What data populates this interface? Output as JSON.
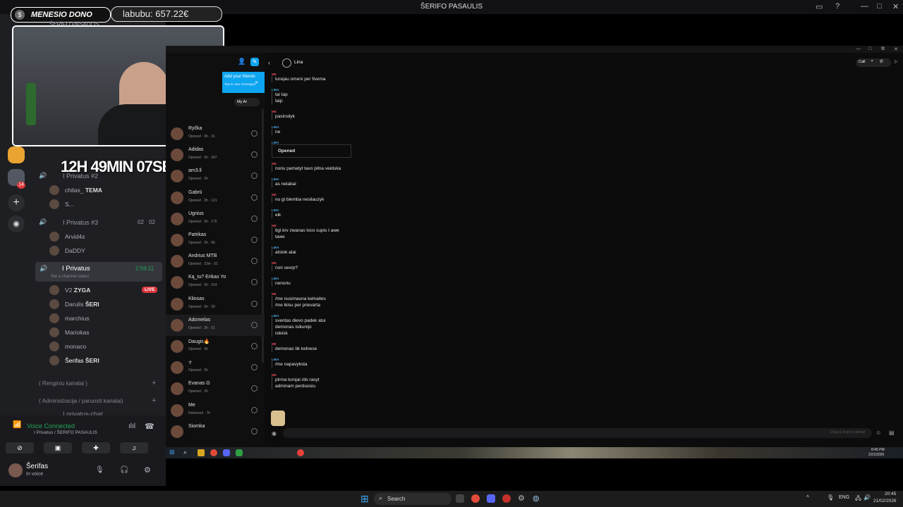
{
  "window": {
    "title": "ŠERIFO PASAULIS"
  },
  "overlay": {
    "donation_label": "MENESIO DONO",
    "donation_value": "labubu: 657.22€",
    "timer": "12H 49MIN 07SEC",
    "server_name": "ŠERIFO PASAULIS"
  },
  "channels": {
    "voice1": {
      "name": "I Privatus #2"
    },
    "voice1_members": [
      {
        "name": "chilas_",
        "tag": "TEMA"
      },
      {
        "name": "S..."
      }
    ],
    "voice2": {
      "name": "I Privatus #3",
      "count_a": "02",
      "count_b": "02"
    },
    "voice2_members": [
      {
        "name": "Arvid4s"
      },
      {
        "name": "DaDDY"
      }
    ],
    "voice3": {
      "name": "I Privatus",
      "timer": "2:59:11",
      "status": "Set a channel status"
    },
    "voice3_members": [
      {
        "name": "V2",
        "tag": "ZYGA",
        "live": "LIVE"
      },
      {
        "name": "Darulis",
        "tag": "ŠERI"
      },
      {
        "name": "marchius"
      },
      {
        "name": "Mariokas"
      },
      {
        "name": "monaco"
      },
      {
        "name": "Šerifas",
        "tag": "ŠERI"
      }
    ],
    "category1": "( Renginiu kanalai )",
    "category2": "( Administracija / paruosti kanalai)",
    "text_channel": "I privatus-chat",
    "guild_badge": "14"
  },
  "voice_panel": {
    "status": "Voice Connected",
    "location": "I Privatus / ŠERIFO PASAULIS",
    "username": "Šerifas",
    "user_status": "In voice"
  },
  "snap": {
    "banner_title": "Add your friends",
    "banner_sub": "Tap to view messages",
    "myai": "My AI",
    "contact": "Lina",
    "call_label": "Call",
    "input_placeholder": "Drag & drop to upload",
    "chats": [
      {
        "name": "Ryčka",
        "status": "Opened · 3h · 31"
      },
      {
        "name": "Adidas",
        "status": "Opened · 3h · 347"
      },
      {
        "name": "am3.ll",
        "status": "Opened · 3h"
      },
      {
        "name": "Gabrū",
        "status": "Opened · 3h · 121"
      },
      {
        "name": "Ugnius",
        "status": "Opened · 3h · 175"
      },
      {
        "name": "Patrikas",
        "status": "Opened · 3h · 96"
      },
      {
        "name": "Andrius MTB",
        "status": "Opened · 23m · 51"
      },
      {
        "name": "Ką_tu? Erikas Yo",
        "status": "Opened · 3h · 314"
      },
      {
        "name": "Kliosas",
        "status": "Opened · 3h · 30"
      },
      {
        "name": "Adomelas",
        "status": "Opened · 3h · 21"
      },
      {
        "name": "Daugis🔥",
        "status": "Opened · 3h"
      },
      {
        "name": "☥",
        "status": "Opened · 3h"
      },
      {
        "name": "Evanas G",
        "status": "Opened · 3h"
      },
      {
        "name": "Me",
        "status": "Delivered · 7h"
      },
      {
        "name": "Siomka"
      }
    ],
    "messages": [
      {
        "who": "ME",
        "lines": [
          "turejau omeni per fivema"
        ]
      },
      {
        "who": "LINA",
        "lines": [
          "tai tap",
          "taip"
        ]
      },
      {
        "who": "ME",
        "lines": [
          "pasirodyk"
        ]
      },
      {
        "who": "LINA",
        "lines": [
          "ne"
        ]
      },
      {
        "who": "LINA",
        "lines": [
          "Opened"
        ]
      },
      {
        "who": "ME",
        "lines": [
          "noriu pamatyt tavo pilna veiduka"
        ]
      },
      {
        "who": "LINA",
        "lines": [
          "as nelabai"
        ]
      },
      {
        "who": "ME",
        "lines": [
          "nu gi blemba nesilauzyk"
        ]
      },
      {
        "who": "LINA",
        "lines": [
          "eik"
        ]
      },
      {
        "who": "ME",
        "lines": [
          "tigi krv zwanas loco supis t awe",
          "tawe"
        ]
      },
      {
        "who": "LINA",
        "lines": [
          "atstok atai"
        ]
      },
      {
        "who": "ME",
        "lines": [
          "nori sexrp?"
        ]
      },
      {
        "who": "LINA",
        "lines": [
          "nenoriu"
        ]
      },
      {
        "who": "ME",
        "lines": [
          "/me nusimauna kelnaites",
          "/me ikisu per prievarta"
        ]
      },
      {
        "who": "LINA",
        "lines": [
          "sventas dievo padek atui",
          "demonas isikunijo",
          "isleisk"
        ]
      },
      {
        "who": "ME",
        "lines": [
          "demonas tik kelnese"
        ]
      },
      {
        "who": "LINA",
        "lines": [
          "/me napavyksta"
        ]
      },
      {
        "who": "ME",
        "lines": [
          "pirma turojai /do rasyt",
          "adminam perduosiu"
        ]
      }
    ]
  },
  "inner_taskbar": {
    "clock": "8:45 PM",
    "date": "2/21/2026"
  },
  "taskbar": {
    "search": "Search",
    "lang": "ENG",
    "time": "20:45",
    "date": "21/02/2026"
  },
  "colors": {
    "accent": "#23a55a",
    "live": "#da373c",
    "snap_blue": "#0ea5f0"
  }
}
